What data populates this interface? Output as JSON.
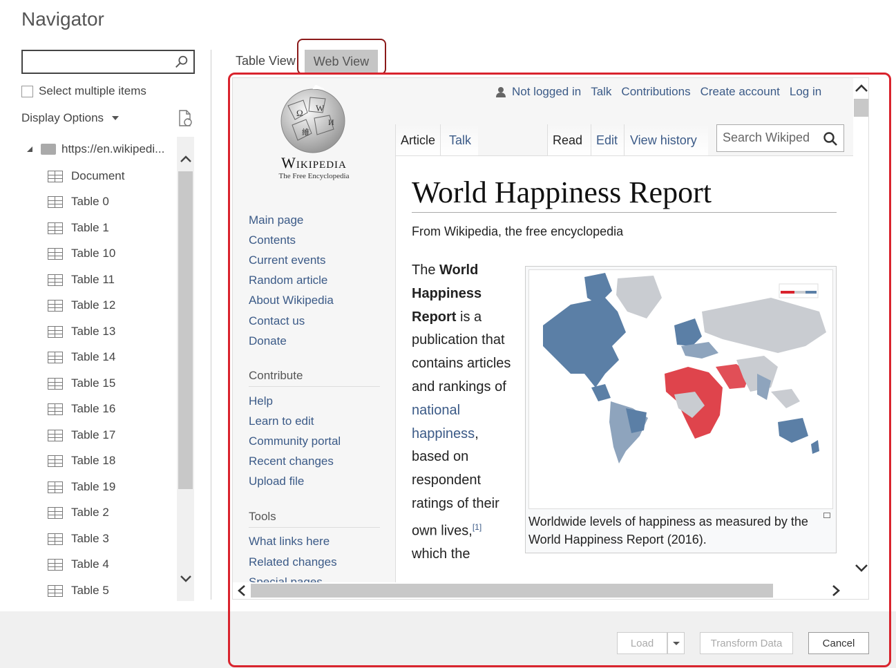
{
  "window": {
    "title": "Navigator"
  },
  "search": {
    "placeholder": ""
  },
  "select_multiple": {
    "label": "Select multiple items"
  },
  "display_options": {
    "label": "Display Options"
  },
  "tree": {
    "root": "https://en.wikipedi...",
    "items": [
      "Document",
      "Table 0",
      "Table 1",
      "Table 10",
      "Table 11",
      "Table 12",
      "Table 13",
      "Table 14",
      "Table 15",
      "Table 16",
      "Table 17",
      "Table 18",
      "Table 19",
      "Table 2",
      "Table 3",
      "Table 4",
      "Table 5"
    ]
  },
  "view_tabs": {
    "table_view": "Table View",
    "web_view": "Web View"
  },
  "wiki": {
    "wordmark": "Wikipedia",
    "tagline": "The Free Encyclopedia",
    "personal": {
      "not_logged_in": "Not logged in",
      "talk": "Talk",
      "contributions": "Contributions",
      "create_account": "Create account",
      "log_in": "Log in"
    },
    "tabs": {
      "article": "Article",
      "talk": "Talk",
      "read": "Read",
      "edit": "Edit",
      "view_history": "View history"
    },
    "search_placeholder": "Search Wikiped",
    "nav_links": [
      "Main page",
      "Contents",
      "Current events",
      "Random article",
      "About Wikipedia",
      "Contact us",
      "Donate"
    ],
    "contribute_heading": "Contribute",
    "contribute_links": [
      "Help",
      "Learn to edit",
      "Community portal",
      "Recent changes",
      "Upload file"
    ],
    "tools_heading": "Tools",
    "tools_links": [
      "What links here",
      "Related changes",
      "Special pages"
    ],
    "article_title": "World Happiness Report",
    "from_line": "From Wikipedia, the free encyclopedia",
    "body": {
      "the": "The",
      "bold": "World Happiness Report",
      "is_a": "is a publication that contains articles and rankings of",
      "link": "national happiness",
      "rest": ", based on respondent ratings of their own lives,",
      "cite": "[1]",
      "tail": "which the"
    },
    "caption": "Worldwide levels of happiness as measured by the World Happiness Report (2016)."
  },
  "buttons": {
    "load": "Load",
    "transform": "Transform Data",
    "cancel": "Cancel"
  },
  "colors": {
    "highlight": "#d9232d",
    "tab_highlight": "#8b1a1a",
    "wiki_link": "#3b5a87",
    "map_blue": "#5b7fa6",
    "map_red": "#d9232d",
    "map_gray": "#c9ccd1"
  }
}
